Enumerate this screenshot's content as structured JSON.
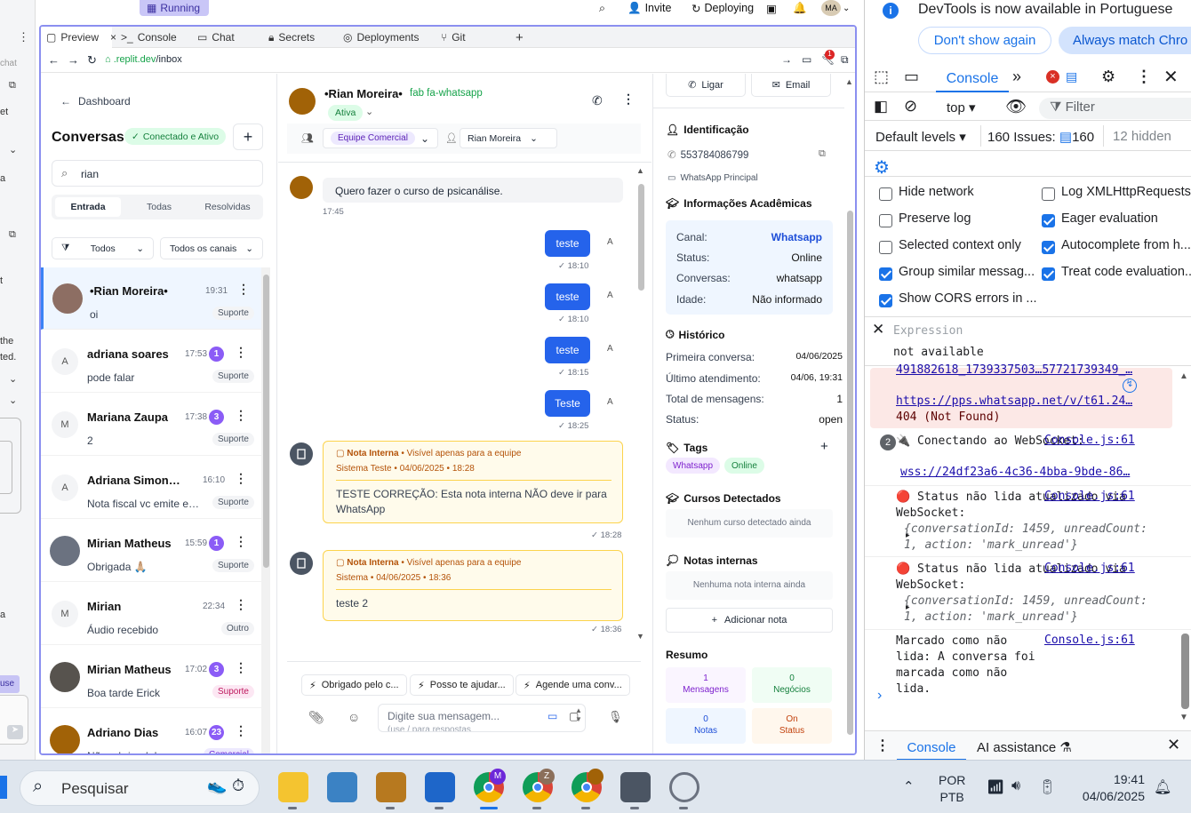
{
  "left_strip": {
    "items": [
      "chat",
      "et",
      "a",
      "t",
      "the",
      "ted.",
      "a",
      "use"
    ]
  },
  "replit": {
    "status": "Running",
    "invite": "Invite",
    "deploying": "Deploying",
    "avatar_initials": "MA",
    "tabs": [
      {
        "label": "Preview"
      },
      {
        "label": "Console"
      },
      {
        "label": "Chat"
      },
      {
        "label": "Secrets"
      },
      {
        "label": "Deployments"
      },
      {
        "label": "Git"
      }
    ],
    "url_host": ".replit.dev",
    "url_path": "/inbox",
    "notif_count": "1"
  },
  "sidebar": {
    "back": "Dashboard",
    "title": "Conversas",
    "status": "Conectado e Ativo",
    "search_value": "rian",
    "tabs": [
      "Entrada",
      "Todas",
      "Resolvidas"
    ],
    "filter_all": "Todos",
    "filter_channels": "Todos os canais",
    "conversations": [
      {
        "initial": "",
        "name": "•Rian Moreira•",
        "time": "19:31",
        "count": "",
        "preview": "oi",
        "tag": "Suporte"
      },
      {
        "initial": "A",
        "name": "adriana soares",
        "time": "17:53",
        "count": "1",
        "preview": "pode falar",
        "tag": "Suporte"
      },
      {
        "initial": "M",
        "name": "Mariana Zaupa",
        "time": "17:38",
        "count": "3",
        "preview": "2",
        "tag": "Suporte"
      },
      {
        "initial": "A",
        "name": "Adriana Simonassi",
        "time": "16:10",
        "count": "",
        "preview": "Nota fiscal vc emite em...",
        "tag": "Suporte"
      },
      {
        "initial": "",
        "name": "Mirian Matheus",
        "time": "15:59",
        "count": "1",
        "preview": "Obrigada 🙏🏼",
        "tag": "Suporte"
      },
      {
        "initial": "M",
        "name": "Mirian",
        "time": "22:34",
        "count": "",
        "preview": "Áudio recebido",
        "tag": "Outro"
      },
      {
        "initial": "",
        "name": "Mirian Matheus",
        "time": "17:02",
        "count": "3",
        "preview": "Boa tarde Erick",
        "tag": "Suporte"
      },
      {
        "initial": "",
        "name": "Adriano Dias",
        "time": "16:07",
        "count": "23",
        "preview": "Não, obrigado!",
        "tag": "Comercial"
      }
    ]
  },
  "chat": {
    "contact_name": "•Rian Moreira•",
    "channel_label": "fab fa-whatsapp",
    "status": "Ativa",
    "team": "Equipe Comercial",
    "agent": "Rian Moreira",
    "incoming": {
      "text": "Quero fazer o curso de psicanálise.",
      "time": "17:45"
    },
    "outgoing": [
      {
        "text": "teste",
        "time": "18:10"
      },
      {
        "text": "teste",
        "time": "18:10"
      },
      {
        "text": "teste",
        "time": "18:15"
      },
      {
        "text": "Teste",
        "time": "18:25"
      }
    ],
    "agent_initial": "A",
    "notes": [
      {
        "title": "Nota Interna",
        "visibility": "Visível apenas para a equipe",
        "author": "Sistema Teste",
        "date": "04/06/2025",
        "time": "18:28",
        "body": "TESTE CORREÇÃO: Esta nota interna NÃO deve ir para WhatsApp",
        "footer_time": "18:28"
      },
      {
        "title": "Nota Interna",
        "visibility": "Visível apenas para a equipe",
        "author": "Sistema",
        "date": "04/06/2025",
        "time": "18:36",
        "body": "teste 2",
        "footer_time": "18:36"
      }
    ],
    "quick_replies": [
      "Obrigado pelo c...",
      "Posso te ajudar...",
      "Agende uma conv..."
    ],
    "input_placeholder": "Digite sua mensagem...",
    "input_hint": "(use / para respostas"
  },
  "info": {
    "call": "Ligar",
    "email": "Email",
    "identification_title": "Identificação",
    "phone": "553784086799",
    "whatsapp_label": "WhatsApp Principal",
    "academic_title": "Informações Acadêmicas",
    "academic": [
      {
        "label": "Canal:",
        "value": "Whatsapp"
      },
      {
        "label": "Status:",
        "value": "Online"
      },
      {
        "label": "Conversas:",
        "value": "whatsapp"
      },
      {
        "label": "Idade:",
        "value": "Não informado"
      }
    ],
    "history_title": "Histórico",
    "history": [
      {
        "label": "Primeira conversa:",
        "value": "04/06/2025"
      },
      {
        "label": "Último atendimento:",
        "value": "04/06, 19:31"
      },
      {
        "label": "Total de mensagens:",
        "value": "1"
      },
      {
        "label": "Status:",
        "value": "open"
      }
    ],
    "tags_title": "Tags",
    "tags": [
      "Whatsapp",
      "Online"
    ],
    "courses_title": "Cursos Detectados",
    "courses_empty": "Nenhum curso detectado ainda",
    "notes_title": "Notas internas",
    "notes_empty": "Nenhuma nota interna ainda",
    "add_note": "Adicionar nota",
    "summary_title": "Resumo",
    "summary": [
      {
        "value": "1",
        "label": "Mensagens"
      },
      {
        "value": "0",
        "label": "Negócios"
      },
      {
        "value": "0",
        "label": "Notas"
      },
      {
        "value": "On",
        "label": "Status"
      }
    ]
  },
  "devtools": {
    "banner": "DevTools is now available in Portuguese",
    "dont_show": "Don't show again",
    "always_match": "Always match Chro",
    "console_tab": "Console",
    "context": "top",
    "filter_placeholder": "Filter",
    "levels": "Default levels",
    "issues_label": "160 Issues:",
    "issues_count": "160",
    "hidden": "12 hidden",
    "options": [
      {
        "label": "Hide network",
        "checked": false
      },
      {
        "label": "Log XMLHttpRequests",
        "checked": false
      },
      {
        "label": "Preserve log",
        "checked": false
      },
      {
        "label": "Eager evaluation",
        "checked": true
      },
      {
        "label": "Selected context only",
        "checked": false
      },
      {
        "label": "Autocomplete from h...",
        "checked": true
      },
      {
        "label": "Group similar messag...",
        "checked": true
      },
      {
        "label": "Treat code evaluation...",
        "checked": true
      },
      {
        "label": "Show CORS errors in ...",
        "checked": true
      }
    ],
    "expression_placeholder": "Expression",
    "expression_value": "not available",
    "error_url_1": "491882618_1739337503…57721739349_…",
    "error_url_2": "https://pps.whatsapp.net/v/t61.24…",
    "error_status": "404 (Not Found)",
    "logs": [
      {
        "count": "2",
        "text": "🔌 Conectando ao WebSocket:",
        "link": "wss://24df23a6-4c36-4bba-9bde-86…",
        "source": "Console.js:61"
      },
      {
        "text": "🔴 Status não lida atualizado via WebSocket:",
        "obj": "{conversationId: 1459, unreadCount: 1, action: 'mark_unread'}",
        "source": "Console.js:61"
      },
      {
        "text": "🔴 Status não lida atualizado via WebSocket:",
        "obj": "{conversationId: 1459, unreadCount: 1, action: 'mark_unread'}",
        "source": "Console.js:61"
      },
      {
        "text": "Marcado como não lida: A conversa foi marcada como não lida.",
        "source": "Console.js:61"
      }
    ],
    "drawer_console": "Console",
    "drawer_ai": "AI assistance"
  },
  "taskbar": {
    "search_placeholder": "Pesquisar",
    "lang1": "POR",
    "lang2": "PTB",
    "time": "19:41",
    "date": "04/06/2025",
    "badge_m": "M",
    "badge_z": "Z"
  },
  "colors": {
    "accent": "#2563eb",
    "whatsapp": "#16a34a",
    "purple": "#8b5cf6",
    "note_bg": "#fffbeb",
    "devtools_blue": "#1a73e8"
  }
}
